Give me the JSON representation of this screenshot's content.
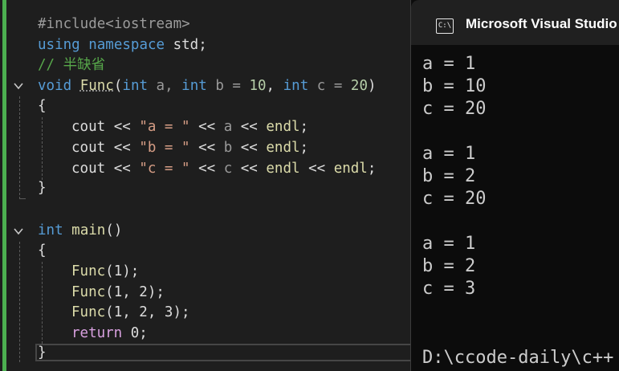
{
  "editor": {
    "lines": {
      "l1": {
        "pp": "#include<iostream>"
      },
      "l2": {
        "kw1": "using",
        "kw2": "namespace",
        "rest": " std;"
      },
      "l3": {
        "comment": "// 半缺省"
      },
      "l4": {
        "t1": "void",
        "fn": "Func",
        "p1": "(",
        "t2": "int",
        "a": " a, ",
        "t3": "int",
        "b": " b = ",
        "n1": "10",
        ",": ", ",
        "t4": "int",
        "c": " c = ",
        "n2": "20",
        "close": ")"
      },
      "l5": {
        "brace": "{"
      },
      "l6": {
        "cout": "cout",
        "op1": " << ",
        "str": "\"a = \"",
        "op2": " << ",
        "v": "a",
        "op3": " << ",
        "endl": "endl",
        ";": ";"
      },
      "l7": {
        "cout": "cout",
        "op1": " << ",
        "str": "\"b = \"",
        "op2": " << ",
        "v": "b",
        "op3": " << ",
        "endl": "endl",
        ";": ";"
      },
      "l8": {
        "cout": "cout",
        "op1": " << ",
        "str": "\"c = \"",
        "op2": " << ",
        "v": "c",
        "op3": " << ",
        "endl": "endl",
        "op4": " << ",
        "endl2": "endl",
        ";": ";"
      },
      "l9": {
        "brace": "}"
      },
      "l11": {
        "kw": "int",
        "fn": "main",
        "rest": "()"
      },
      "l12": {
        "brace": "{"
      },
      "l13": {
        "fn": "Func",
        "rest": "(1);"
      },
      "l14": {
        "fn": "Func",
        "rest": "(1, 2);"
      },
      "l15": {
        "fn": "Func",
        "rest": "(1, 2, 3);"
      },
      "l16": {
        "kw": "return",
        "rest": " 0;"
      },
      "l17": {
        "brace": "}"
      }
    }
  },
  "console": {
    "title": "Microsoft Visual Studio",
    "icon": "C:\\",
    "output": "a = 1\nb = 10\nc = 20\n\na = 1\nb = 2\nc = 20\n\na = 1\nb = 2\nc = 3",
    "path": "D:\\ccode-daily\\c++"
  },
  "colors": {
    "keyword": "#569cd6",
    "function": "#dcdcaa",
    "string": "#d69d85",
    "number": "#b5cea8",
    "comment": "#57a64a",
    "git_added": "#4caf50"
  }
}
